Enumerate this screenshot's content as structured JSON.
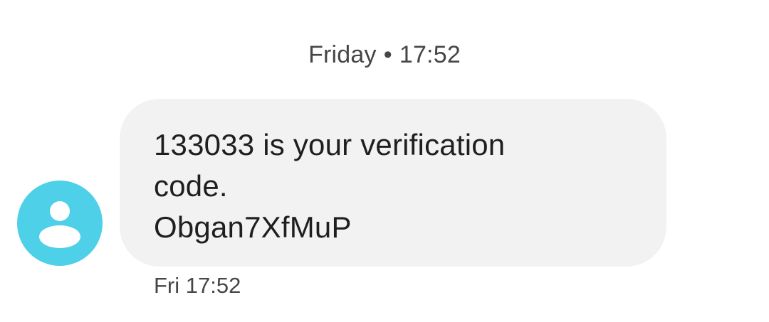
{
  "conversation": {
    "date_divider": {
      "day": "Friday",
      "separator": "•",
      "time": "17:52"
    },
    "message": {
      "text": "133033 is your verification\ncode.\nObgan7XfMuP",
      "timestamp": "Fri 17:52",
      "avatar_icon": "person-icon",
      "avatar_color": "#4dd0e8",
      "bubble_color": "#f2f2f2"
    }
  }
}
